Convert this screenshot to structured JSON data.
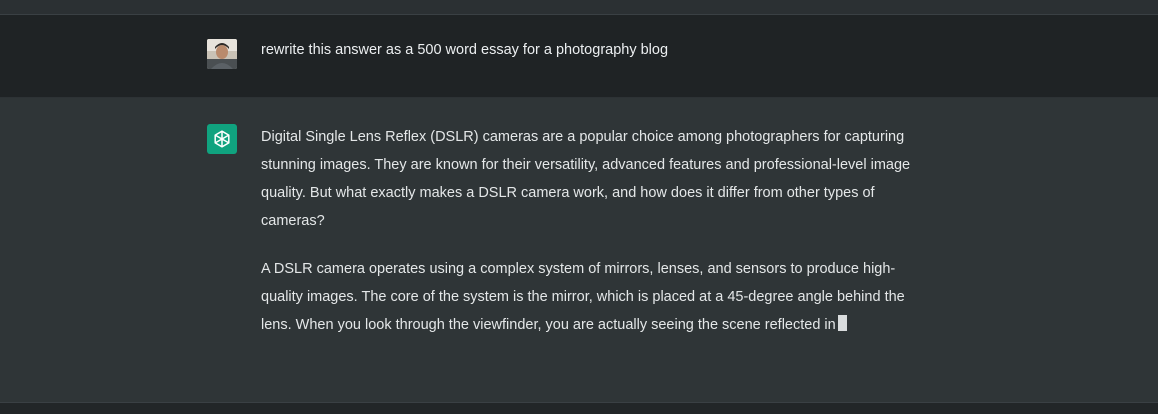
{
  "conversation": {
    "user_message": {
      "text": "rewrite this answer as a 500 word essay for a photography blog",
      "avatar_icon": "user-avatar-photo"
    },
    "assistant_message": {
      "icon": "openai-logo-icon",
      "accent_color": "#10a37f",
      "paragraphs": [
        "Digital Single Lens Reflex (DSLR) cameras are a popular choice among photographers for capturing stunning images. They are known for their versatility, advanced features and professional-level image quality. But what exactly makes a DSLR camera work, and how does it differ from other types of cameras?",
        "A DSLR camera operates using a complex system of mirrors, lenses, and sensors to produce high-quality images. The core of the system is the mirror, which is placed at a 45-degree angle behind the lens. When you look through the viewfinder, you are actually seeing the scene reflected in"
      ],
      "streaming": true
    }
  }
}
